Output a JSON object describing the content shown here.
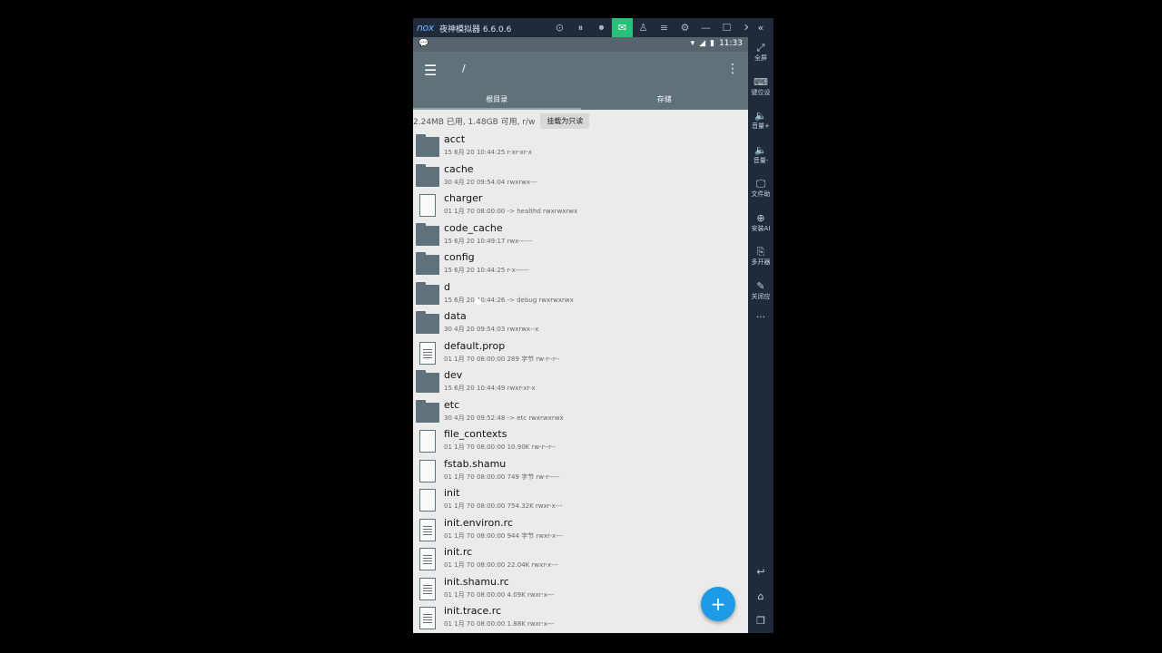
{
  "emulator": {
    "logo": "nox",
    "title": "夜神模拟器 6.6.0.6",
    "toolbar_icons": [
      "stop-icon",
      "pause-icon",
      "record-icon",
      "message-icon",
      "shirt-icon",
      "menu-icon",
      "gear-icon",
      "minimize-icon",
      "maximize-icon",
      "close-icon"
    ],
    "collapse_icon": "«",
    "sidebar": [
      {
        "icon": "⤢",
        "label": "全屏"
      },
      {
        "icon": "⌨",
        "label": "键位设"
      },
      {
        "icon": "🔈",
        "label": "音量+"
      },
      {
        "icon": "🔈",
        "label": "音量-"
      },
      {
        "icon": "🖵",
        "label": "文件助"
      },
      {
        "icon": "⊕",
        "label": "安装AI"
      },
      {
        "icon": "⎘",
        "label": "多开器"
      },
      {
        "icon": "✎",
        "label": "关闭应"
      }
    ],
    "more": "···"
  },
  "status": {
    "time": "11:33"
  },
  "appbar": {
    "path": "/"
  },
  "tabs": [
    "根目录",
    "存储"
  ],
  "info": {
    "text": "2.24MB 已用, 1.48GB 可用, r/w",
    "button": "挂载为只读"
  },
  "files": [
    {
      "name": "acct",
      "meta": "15 6月 20 10:44:25   r-xr-xr-x",
      "type": "folder"
    },
    {
      "name": "cache",
      "meta": "30 4月 20 09:54:04   rwxrwx---",
      "type": "folder"
    },
    {
      "name": "charger",
      "meta": "01 1月 70 08:00:00  -> healthd  rwxrwxrwx",
      "type": "file"
    },
    {
      "name": "code_cache",
      "meta": "15 6月 20 10:49:17   rwx------",
      "type": "folder"
    },
    {
      "name": "config",
      "meta": "15 6月 20 10:44:25   r-x------",
      "type": "folder"
    },
    {
      "name": "d",
      "meta": "15 6月 20 10:44:26  -> debug  rwxrwxrwx",
      "type": "folder"
    },
    {
      "name": "data",
      "meta": "30 4月 20 09:54:03   rwxrwx--x",
      "type": "folder"
    },
    {
      "name": "default.prop",
      "meta": "01 1月 70 08:00:00  289 字节  rw-r--r--",
      "type": "text"
    },
    {
      "name": "dev",
      "meta": "15 6月 20 10:44:49   rwxr-xr-x",
      "type": "folder"
    },
    {
      "name": "etc",
      "meta": "30 4月 20 09:52:48  -> etc  rwxrwxrwx",
      "type": "folder"
    },
    {
      "name": "file_contexts",
      "meta": "01 1月 70 08:00:00  10.90K  rw-r--r--",
      "type": "file"
    },
    {
      "name": "fstab.shamu",
      "meta": "01 1月 70 08:00:00  749 字节  rw-r-----",
      "type": "file"
    },
    {
      "name": "init",
      "meta": "01 1月 70 08:00:00  754.32K  rwxr-x---",
      "type": "file"
    },
    {
      "name": "init.environ.rc",
      "meta": "01 1月 70 08:00:00  944 字节  rwxr-x---",
      "type": "text"
    },
    {
      "name": "init.rc",
      "meta": "01 1月 70 08:00:00  22.04K  rwxr-x---",
      "type": "text"
    },
    {
      "name": "init.shamu.rc",
      "meta": "01 1月 70 08:00:00  4.09K  rwxr-x---",
      "type": "text"
    },
    {
      "name": "init.trace.rc",
      "meta": "01 1月 70 08:00:00  1.88K  rwxr-x---",
      "type": "text"
    }
  ],
  "fab": "+"
}
